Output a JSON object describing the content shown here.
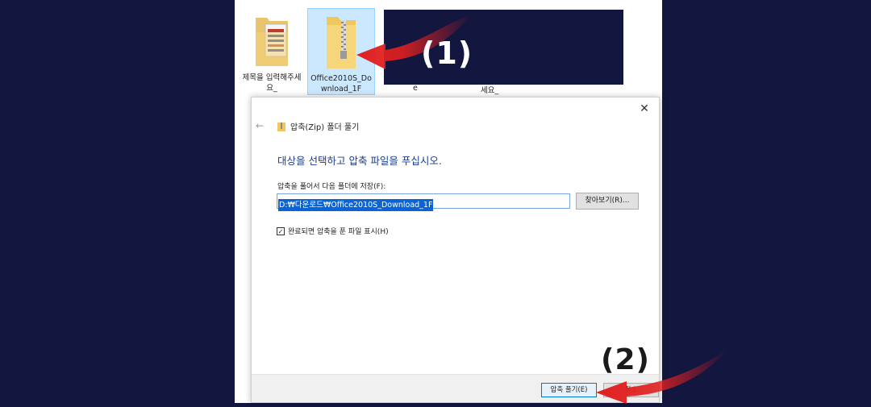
{
  "explorer": {
    "items": [
      {
        "name": "제목을 입력해주세요_",
        "icon": "folder-with-documents-icon"
      },
      {
        "name": "Office2010S_Download_1F",
        "icon": "zip-folder-icon",
        "selected": true
      }
    ],
    "partial_labels": [
      "e",
      "세요_"
    ]
  },
  "annotations": {
    "step1": "(1)",
    "step2": "(2)",
    "arrow_color": "#e02020"
  },
  "dialog": {
    "close_label": "✕",
    "back_label": "←",
    "title": "압축(Zip) 폴더 풀기",
    "instruction": "대상을 선택하고 압축 파일을 푸십시오.",
    "path_label": "압축을 풀어서 다음 폴더에 저장(F):",
    "path_value": "D:₩다운로드₩Office2010S_Download_1F",
    "browse_label": "찾아보기(R)...",
    "checkbox_label": "완료되면 압축을 푼 파일 표시(H)",
    "checkbox_checked": true,
    "extract_label": "압축 풀기(E)",
    "cancel_label": "취소"
  },
  "colors": {
    "background": "#13163f",
    "accent": "#0078d7",
    "instruction_text": "#1a3d8f"
  }
}
